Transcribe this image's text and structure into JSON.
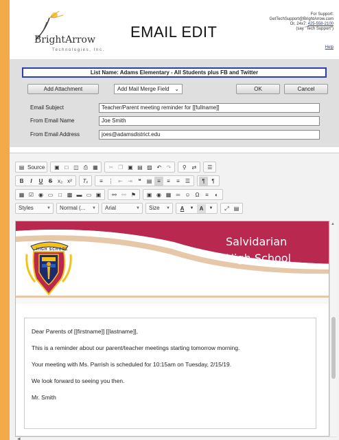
{
  "header": {
    "brand": "BrightArrow",
    "brand_sub": "Technologies, Inc.",
    "title": "EMAIL EDIT",
    "support_line1": "For Support:",
    "support_line2": "GetTechSupport@BrightArrow.com",
    "support_line3_prefix": "Or, 24x7: ",
    "support_phone": "425-558-2100",
    "support_line4": "(say \"Tech Support\")",
    "help": "Help"
  },
  "form": {
    "list_name": "List Name: Adams Elementary - All Students plus FB and Twitter",
    "add_attachment": "Add Attachment",
    "merge_field": "Add Mail Merge Field",
    "ok": "OK",
    "cancel": "Cancel",
    "subject_label": "Email Subject",
    "subject_value": "Teacher/Parent meeting reminder for [[fullname]]",
    "from_name_label": "From Email Name",
    "from_name_value": "Joe Smith",
    "from_address_label": "From Email Address",
    "from_address_value": "joes@adamsdistrict.edu"
  },
  "toolbar": {
    "source": "Source",
    "styles": "Styles",
    "format": "Normal (...",
    "font": "Arial",
    "size": "Size"
  },
  "content": {
    "school_line1": "Salvidarian",
    "school_line2": "High School",
    "crest_text": "HIGH SCHOOL",
    "greeting": "Dear Parents of [[firstname]] [[lastname]],",
    "line1": "This is a reminder about our parent/teacher meetings starting tomorrow morning.",
    "line2": "Your meeting with Ms. Parrish is scheduled for 10:15am on Tuesday, 2/15/19.",
    "line3": "We look forward to seeing you then.",
    "signature": "Mr. Smith"
  },
  "colors": {
    "background": "#f3ab4a",
    "list_border": "#2b3fa8",
    "banner_magenta": "#b8284f",
    "banner_tan": "#e6c8a8",
    "crest_navy": "#1f2a6e",
    "crest_gold": "#f2c21b"
  }
}
